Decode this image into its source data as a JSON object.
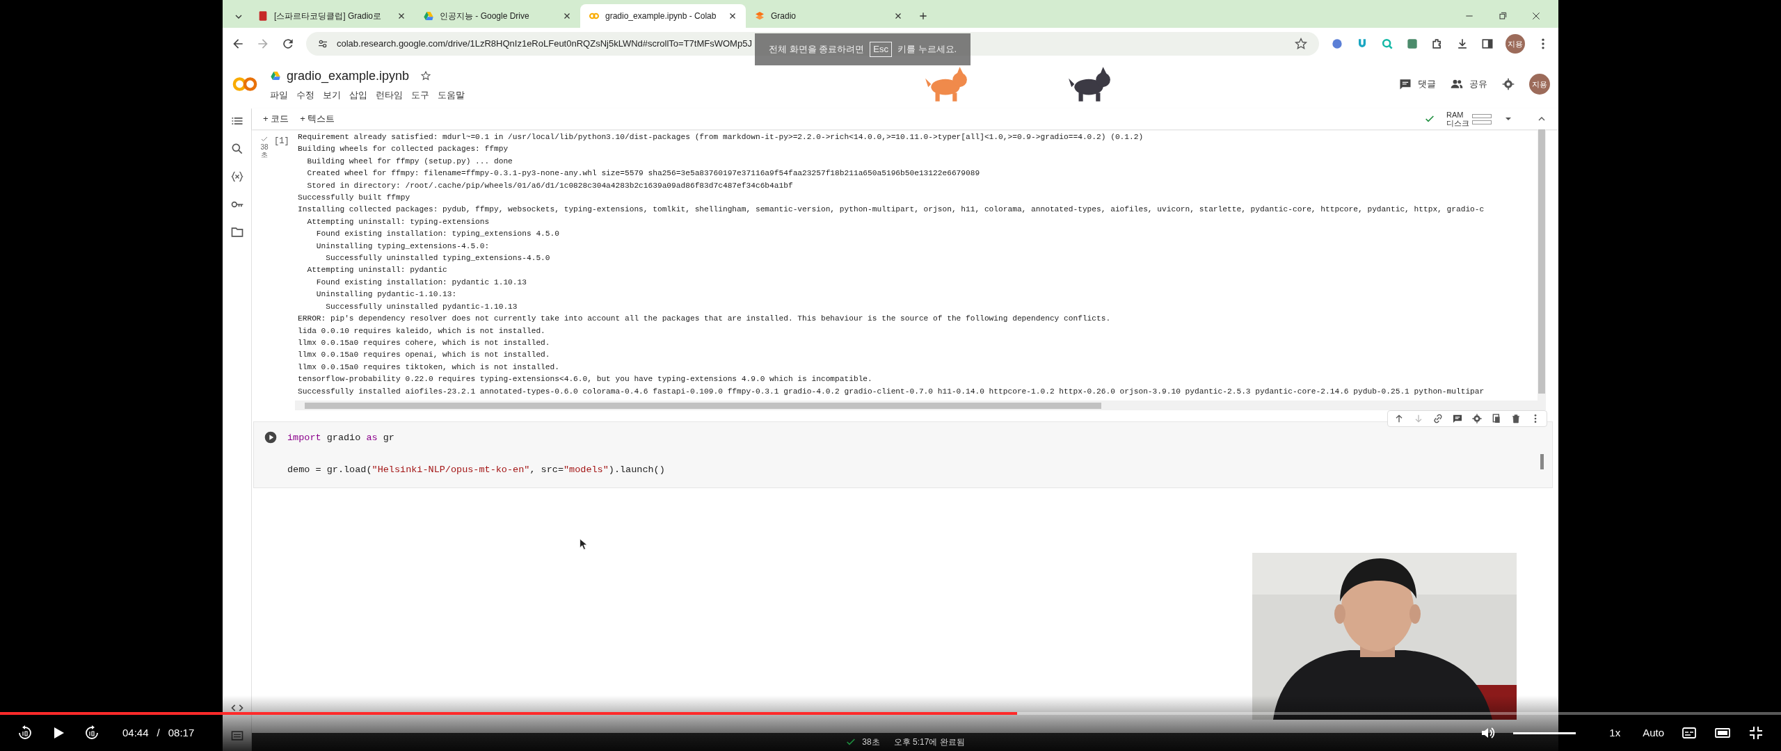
{
  "browser": {
    "tabs": [
      {
        "title": "[스파르타코딩클럽] Gradio로",
        "kind": "book",
        "selected": false
      },
      {
        "title": "인공지능 - Google Drive",
        "kind": "drive",
        "selected": false
      },
      {
        "title": "gradio_example.ipynb - Colab",
        "kind": "colab",
        "selected": true
      },
      {
        "title": "Gradio",
        "kind": "gradio",
        "selected": false
      }
    ],
    "url": "colab.research.google.com/drive/1LzR8HQnIz1eRoLFeut0nRQZsNj5kLWNd#scrollTo=T7tMFsWOMp5J",
    "profile": "지용",
    "fullscreen_notice": {
      "before": "전체 화면을 종료하려면",
      "key": "Esc",
      "after": "키를 누르세요."
    }
  },
  "colab": {
    "title": "gradio_example.ipynb",
    "menu": [
      "파일",
      "수정",
      "보기",
      "삽입",
      "런타임",
      "도구",
      "도움말"
    ],
    "actions": {
      "comment": "댓글",
      "share": "공유",
      "avatar": "지용"
    },
    "toolbar": [
      "+ 코드",
      "+ 텍스트"
    ],
    "resources": {
      "ram": "RAM",
      "disk": "디스크"
    },
    "output_cell": {
      "count": "[1]",
      "duration": "38\n초",
      "lines": [
        "Requirement already satisfied: mdurl~=0.1 in /usr/local/lib/python3.10/dist-packages (from markdown-it-py>=2.2.0->rich<14.0.0,>=10.11.0->typer[all]<1.0,>=0.9->gradio==4.0.2) (0.1.2)",
        "Building wheels for collected packages: ffmpy",
        "  Building wheel for ffmpy (setup.py) ... done",
        "  Created wheel for ffmpy: filename=ffmpy-0.3.1-py3-none-any.whl size=5579 sha256=3e5a83760197e37116a9f54faa23257f18b211a650a5196b50e13122e6679089",
        "  Stored in directory: /root/.cache/pip/wheels/01/a6/d1/1c0828c304a4283b2c1639a09ad86f83d7c487ef34c6b4a1bf",
        "Successfully built ffmpy",
        "Installing collected packages: pydub, ffmpy, websockets, typing-extensions, tomlkit, shellingham, semantic-version, python-multipart, orjson, h11, colorama, annotated-types, aiofiles, uvicorn, starlette, pydantic-core, httpcore, pydantic, httpx, gradio-c",
        "  Attempting uninstall: typing-extensions",
        "    Found existing installation: typing_extensions 4.5.0",
        "    Uninstalling typing_extensions-4.5.0:",
        "      Successfully uninstalled typing_extensions-4.5.0",
        "  Attempting uninstall: pydantic",
        "    Found existing installation: pydantic 1.10.13",
        "    Uninstalling pydantic-1.10.13:",
        "      Successfully uninstalled pydantic-1.10.13",
        "ERROR: pip's dependency resolver does not currently take into account all the packages that are installed. This behaviour is the source of the following dependency conflicts.",
        "lida 0.0.10 requires kaleido, which is not installed.",
        "llmx 0.0.15a0 requires cohere, which is not installed.",
        "llmx 0.0.15a0 requires openai, which is not installed.",
        "llmx 0.0.15a0 requires tiktoken, which is not installed.",
        "tensorflow-probability 0.22.0 requires typing-extensions<4.6.0, but you have typing-extensions 4.9.0 which is incompatible.",
        "Successfully installed aiofiles-23.2.1 annotated-types-0.6.0 colorama-0.4.6 fastapi-0.109.0 ffmpy-0.3.1 gradio-4.0.2 gradio-client-0.7.0 h11-0.14.0 httpcore-1.0.2 httpx-0.26.0 orjson-3.9.10 pydantic-2.5.3 pydantic-core-2.14.6 pydub-0.25.1 python-multipar"
      ]
    },
    "code_cell": {
      "lines": [
        [
          {
            "kind": "keyword",
            "text": "import"
          },
          {
            "kind": "plain",
            "text": " gradio "
          },
          {
            "kind": "keyword",
            "text": "as"
          },
          {
            "kind": "plain",
            "text": " gr"
          }
        ],
        [
          {
            "kind": "plain",
            "text": "demo = gr.load("
          },
          {
            "kind": "string",
            "text": "\"Helsinki-NLP/opus-mt-ko-en\""
          },
          {
            "kind": "plain",
            "text": ", src="
          },
          {
            "kind": "string",
            "text": "\"models\""
          },
          {
            "kind": "plain",
            "text": ").launch()"
          }
        ]
      ]
    },
    "status_bar": {
      "duration": "38초",
      "message": "오후 5:17에 완료됨"
    }
  },
  "player": {
    "progress": {
      "level": 0.571
    },
    "current_time": "04:44",
    "separator": "/",
    "total_time": "08:17",
    "volume": {
      "level": 1.0
    },
    "speed": "1x",
    "quality": "Auto"
  }
}
